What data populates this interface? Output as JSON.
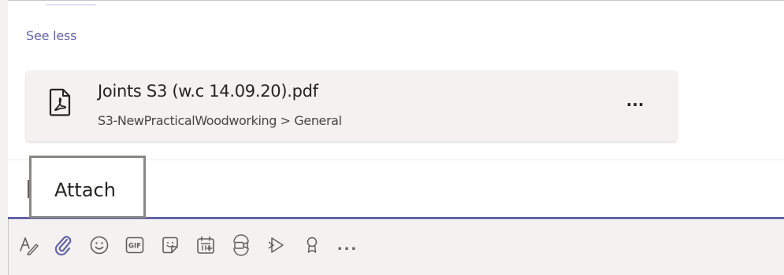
{
  "message": {
    "see_less_label": "See less"
  },
  "attachment": {
    "file_name": "Joints S3 (w.c 14.09.20).pdf",
    "location": "S3-NewPracticalWoodworking > General",
    "file_icon": "pdf-file-icon",
    "more_label": "..."
  },
  "tooltip": {
    "label": "Attach"
  },
  "toolbar": {
    "items": [
      {
        "icon": "format-text-icon"
      },
      {
        "icon": "paperclip-icon"
      },
      {
        "icon": "emoji-icon"
      },
      {
        "icon": "gif-icon"
      },
      {
        "icon": "sticker-icon"
      },
      {
        "icon": "schedule-meeting-icon"
      },
      {
        "icon": "meet-now-icon"
      },
      {
        "icon": "stream-icon"
      },
      {
        "icon": "praise-icon"
      },
      {
        "icon": "more-options-icon"
      }
    ],
    "more_label": "...",
    "gif_label": "GIF"
  },
  "colors": {
    "accent": "#6264a7",
    "text": "#252423",
    "icon": "#605e5c"
  }
}
